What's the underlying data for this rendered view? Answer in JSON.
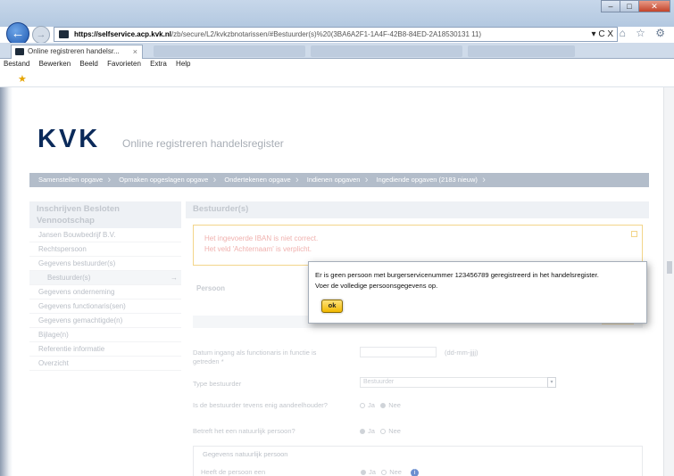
{
  "browser": {
    "url_host": "https://selfservice.acp.kvk.nl",
    "url_path": "/zb/secure/L2/kvkzbnotarissen/#Bestuurder(s)%20(3BA6A2F1-1A4F-42B8-84ED-2A18530131 11)",
    "url_tools": "▾ C X",
    "tab_title": "Online registreren handelsr...",
    "tab_close": "×",
    "menu": [
      "Bestand",
      "Bewerken",
      "Beeld",
      "Favorieten",
      "Extra",
      "Help"
    ],
    "window_controls": [
      "–",
      "□",
      "✕"
    ],
    "chrome_icons": "⌂ ☆ ⚙"
  },
  "header": {
    "logo": "KVK",
    "subtitle": "Online registreren handelsregister"
  },
  "steps": [
    "Samenstellen opgave",
    "Opmaken opgeslagen opgave",
    "Ondertekenen opgave",
    "Indienen opgaven",
    "Ingediende opgaven (2183 nieuw)"
  ],
  "sidebar": {
    "heading": "Inschrijven Besloten Vennootschap",
    "items": [
      {
        "label": "Jansen Bouwbedrijf B.V."
      },
      {
        "label": "Rechtspersoon"
      },
      {
        "label": "Gegevens bestuurder(s)"
      },
      {
        "label": "Bestuurder(s)",
        "arrow": "→"
      },
      {
        "label": "Gegevens onderneming"
      },
      {
        "label": "Gegevens functionaris(sen)"
      },
      {
        "label": "Gegevens gemachtigde(n)"
      },
      {
        "label": "Bijlage(n)"
      },
      {
        "label": "Referentie informatie"
      },
      {
        "label": "Overzicht"
      }
    ]
  },
  "main": {
    "heading": "Bestuurder(s)",
    "errors": [
      "Het ingevoerde IBAN is niet correct.",
      "Het veld 'Achternaam' is verplicht."
    ],
    "section_person": "Persoon",
    "form": {
      "date_label": "Datum ingang als functionaris in functie is getreden *",
      "date_hint": "(dd-mm-jjjj)",
      "type_label": "Type bestuurder",
      "type_value": "Bestuurder",
      "sole_label": "Is de bestuurder tevens enig aandeelhouder?",
      "natural_label": "Betreft het een natuurlijk persoon?",
      "yes": "Ja",
      "no": "Nee",
      "info": "i",
      "fieldset_title": "Gegevens natuurlijk persoon",
      "bsn_label": "Heeft de persoon een"
    }
  },
  "dialog": {
    "message_line1": "Er is geen persoon met burgerservicenummer 123456789 geregistreerd in het handelsregister.",
    "message_line2": "Voer de volledige persoonsgegevens op.",
    "ok_label": "ok"
  }
}
